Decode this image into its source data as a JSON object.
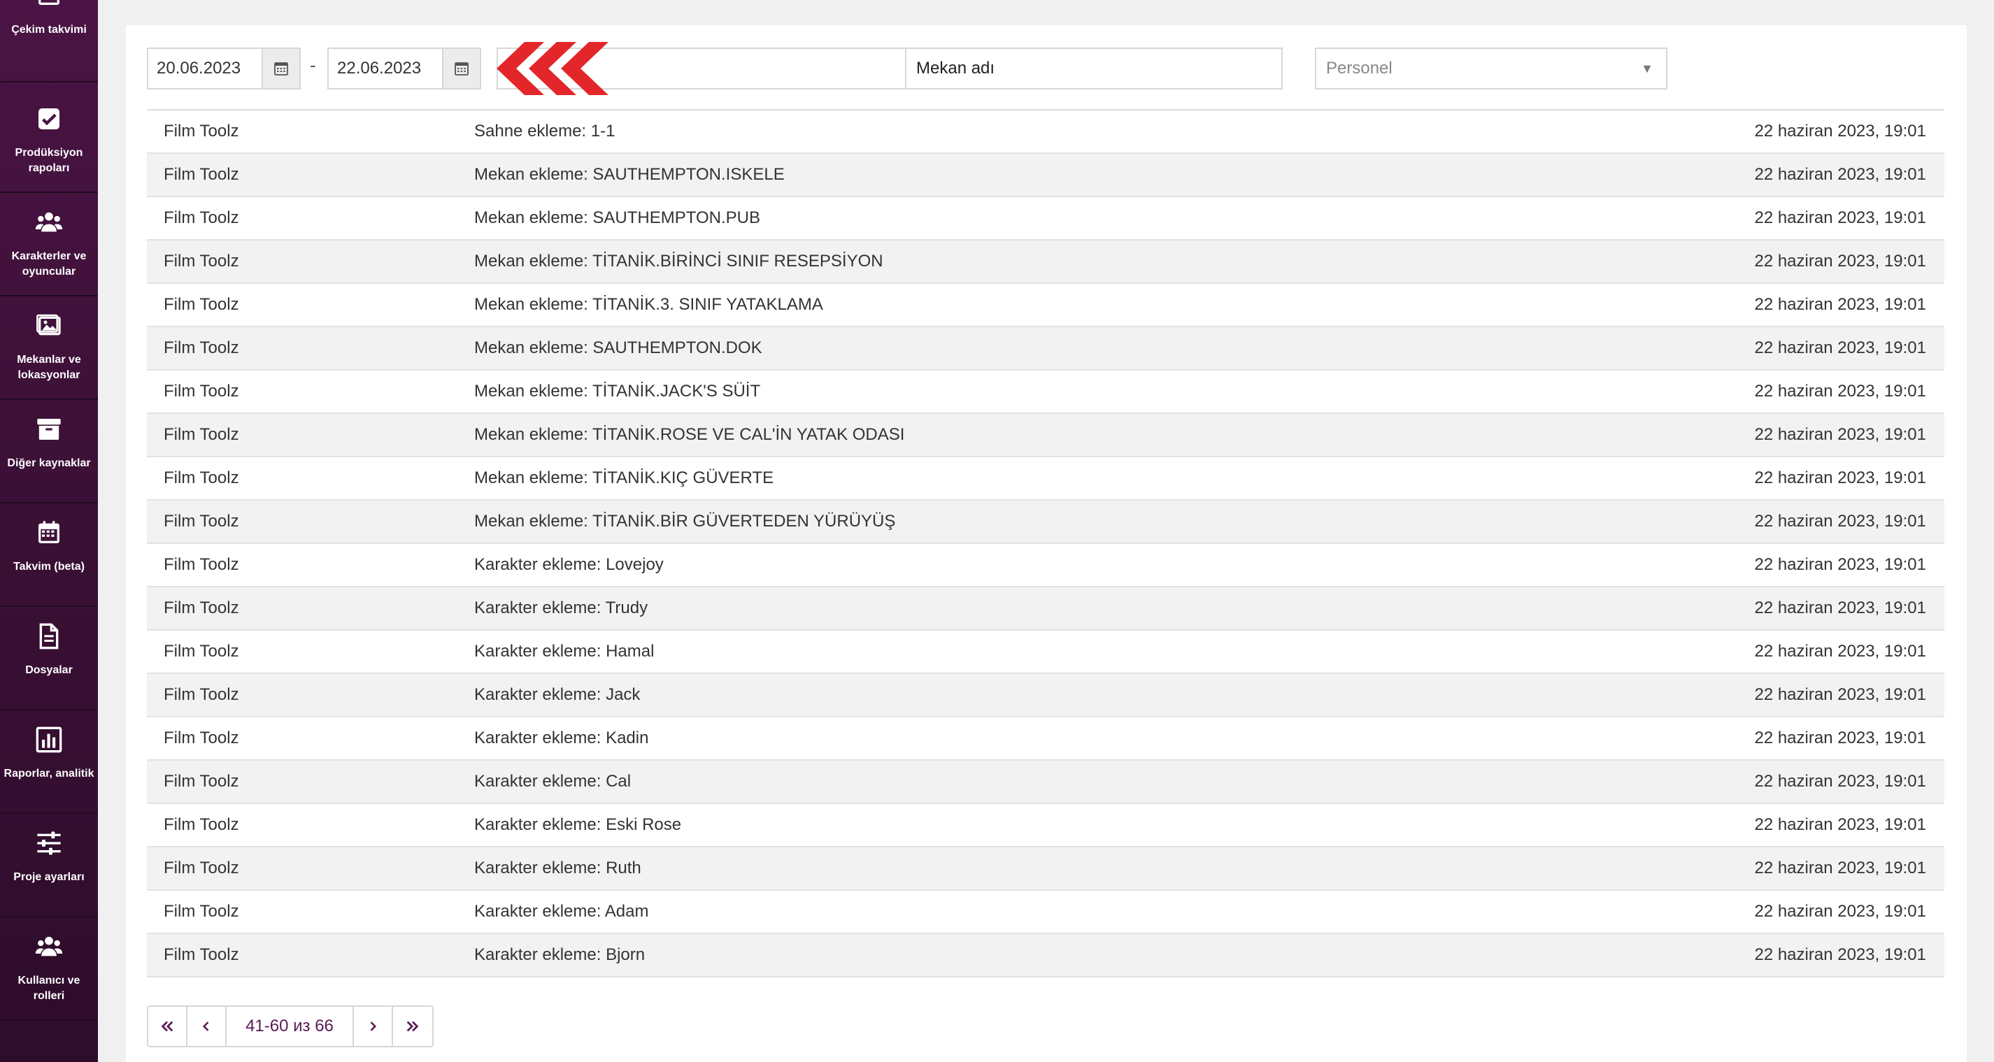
{
  "sidebar": {
    "items": [
      {
        "label": "Çekim takvimi",
        "icon": "calendar-icon"
      },
      {
        "label": "Prodüksiyon\nrapoları",
        "icon": "checkbox-icon"
      },
      {
        "label": "Karakterler ve\noyuncular",
        "icon": "users-icon"
      },
      {
        "label": "Mekanlar ve\nlokasyonlar",
        "icon": "image-icon"
      },
      {
        "label": "Diğer kaynaklar",
        "icon": "archive-icon"
      },
      {
        "label": "Takvim (beta)",
        "icon": "calendar-icon"
      },
      {
        "label": "Dosyalar",
        "icon": "file-icon"
      },
      {
        "label": "Raporlar, analitik",
        "icon": "bar-chart-icon"
      },
      {
        "label": "Proje ayarları",
        "icon": "sliders-icon"
      },
      {
        "label": "Kullanıcı ve\nrolleri",
        "icon": "users-icon"
      }
    ]
  },
  "filters": {
    "date_from": "20.06.2023",
    "date_separator": "-",
    "date_to": "22.06.2023",
    "location_value": "Mekan adı",
    "personnel_placeholder": "Personel"
  },
  "rows": [
    {
      "user": "Film Toolz",
      "action": "Sahne ekleme: 1-1",
      "time": "22 haziran 2023, 19:01"
    },
    {
      "user": "Film Toolz",
      "action": "Mekan ekleme: SAUTHEMPTON.ISKELE",
      "time": "22 haziran 2023, 19:01"
    },
    {
      "user": "Film Toolz",
      "action": "Mekan ekleme: SAUTHEMPTON.PUB",
      "time": "22 haziran 2023, 19:01"
    },
    {
      "user": "Film Toolz",
      "action": "Mekan ekleme: TİTANİK.BİRİNCİ SINIF RESEPSİYON",
      "time": "22 haziran 2023, 19:01"
    },
    {
      "user": "Film Toolz",
      "action": "Mekan ekleme: TİTANİK.3. SINIF YATAKLAMA",
      "time": "22 haziran 2023, 19:01"
    },
    {
      "user": "Film Toolz",
      "action": "Mekan ekleme: SAUTHEMPTON.DOK",
      "time": "22 haziran 2023, 19:01"
    },
    {
      "user": "Film Toolz",
      "action": "Mekan ekleme: TİTANİK.JACK'S SÜİT",
      "time": "22 haziran 2023, 19:01"
    },
    {
      "user": "Film Toolz",
      "action": "Mekan ekleme: TİTANİK.ROSE VE CAL'İN YATAK ODASI",
      "time": "22 haziran 2023, 19:01"
    },
    {
      "user": "Film Toolz",
      "action": "Mekan ekleme: TİTANİK.KIÇ GÜVERTE",
      "time": "22 haziran 2023, 19:01"
    },
    {
      "user": "Film Toolz",
      "action": "Mekan ekleme: TİTANİK.BİR GÜVERTEDEN YÜRÜYÜŞ",
      "time": "22 haziran 2023, 19:01"
    },
    {
      "user": "Film Toolz",
      "action": "Karakter ekleme: Lovejoy",
      "time": "22 haziran 2023, 19:01"
    },
    {
      "user": "Film Toolz",
      "action": "Karakter ekleme: Trudy",
      "time": "22 haziran 2023, 19:01"
    },
    {
      "user": "Film Toolz",
      "action": "Karakter ekleme: Hamal",
      "time": "22 haziran 2023, 19:01"
    },
    {
      "user": "Film Toolz",
      "action": "Karakter ekleme: Jack",
      "time": "22 haziran 2023, 19:01"
    },
    {
      "user": "Film Toolz",
      "action": "Karakter ekleme: Kadin",
      "time": "22 haziran 2023, 19:01"
    },
    {
      "user": "Film Toolz",
      "action": "Karakter ekleme: Cal",
      "time": "22 haziran 2023, 19:01"
    },
    {
      "user": "Film Toolz",
      "action": "Karakter ekleme: Eski Rose",
      "time": "22 haziran 2023, 19:01"
    },
    {
      "user": "Film Toolz",
      "action": "Karakter ekleme: Ruth",
      "time": "22 haziran 2023, 19:01"
    },
    {
      "user": "Film Toolz",
      "action": "Karakter ekleme: Adam",
      "time": "22 haziran 2023, 19:01"
    },
    {
      "user": "Film Toolz",
      "action": "Karakter ekleme: Bjorn",
      "time": "22 haziran 2023, 19:01"
    }
  ],
  "pager": {
    "info": "41-60 из 66"
  },
  "colors": {
    "sidebar": "#3b1236",
    "accent": "#5a1a52",
    "logo_red": "#e3262a"
  }
}
